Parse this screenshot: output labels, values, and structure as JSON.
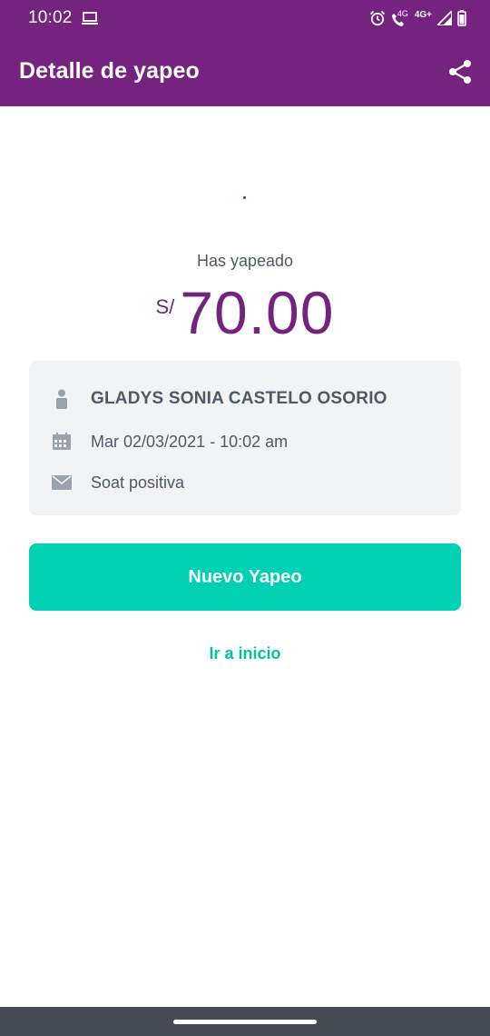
{
  "status_bar": {
    "time": "10:02",
    "network_label_1": "4G",
    "network_label_2": "4G+",
    "icons": [
      "laptop-icon",
      "alarm-icon",
      "volte-call-icon",
      "signal-icon",
      "battery-icon"
    ]
  },
  "app_bar": {
    "title": "Detalle de yapeo",
    "share_icon": "share-icon"
  },
  "summary": {
    "label": "Has yapeado",
    "currency": "S/",
    "amount": "70.00"
  },
  "details": {
    "name": "GLADYS SONIA CASTELO OSORIO",
    "date": "Mar 02/03/2021 - 10:02 am",
    "message": "Soat positiva",
    "icons": [
      "person-icon",
      "calendar-icon",
      "envelope-icon"
    ]
  },
  "actions": {
    "primary_label": "Nuevo Yapeo",
    "link_label": "Ir a inicio"
  },
  "colors": {
    "brand_purple": "#74247f",
    "accent_teal": "#00d1b5",
    "text_gray": "#4e5a68",
    "card_bg": "#f1f3f5"
  }
}
